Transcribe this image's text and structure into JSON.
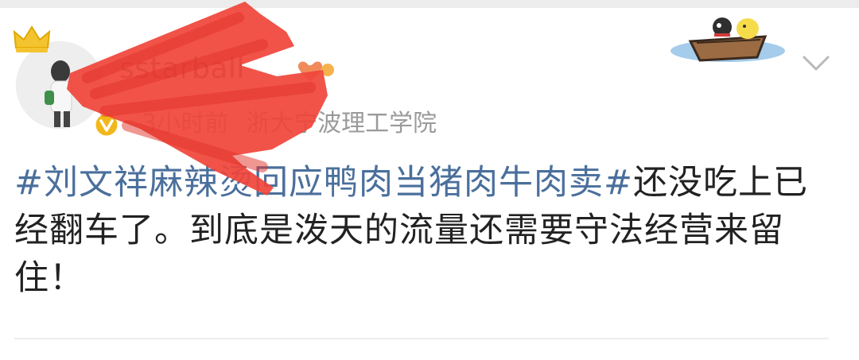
{
  "post": {
    "username": "sstarball",
    "time": "3小时前",
    "source": "浙大宁波理工学院",
    "hashtag": "#刘文祥麻辣烫回应鸭肉当猪肉牛肉卖#",
    "body_text": "还没吃上已经翻车了。到底是泼天的流量还需要守法经营来留住！"
  },
  "icons": {
    "crown": "crown-icon",
    "verified": "verified-badge-icon",
    "member": "member-heart-icon",
    "more": "chevron-down-icon",
    "sticker": "boat-sticker-icon"
  },
  "colors": {
    "hashtag": "#4a6f9c",
    "text": "#222222",
    "meta": "#9a9a9a",
    "verified": "#f2b81a",
    "scribble": "#f0443a"
  }
}
